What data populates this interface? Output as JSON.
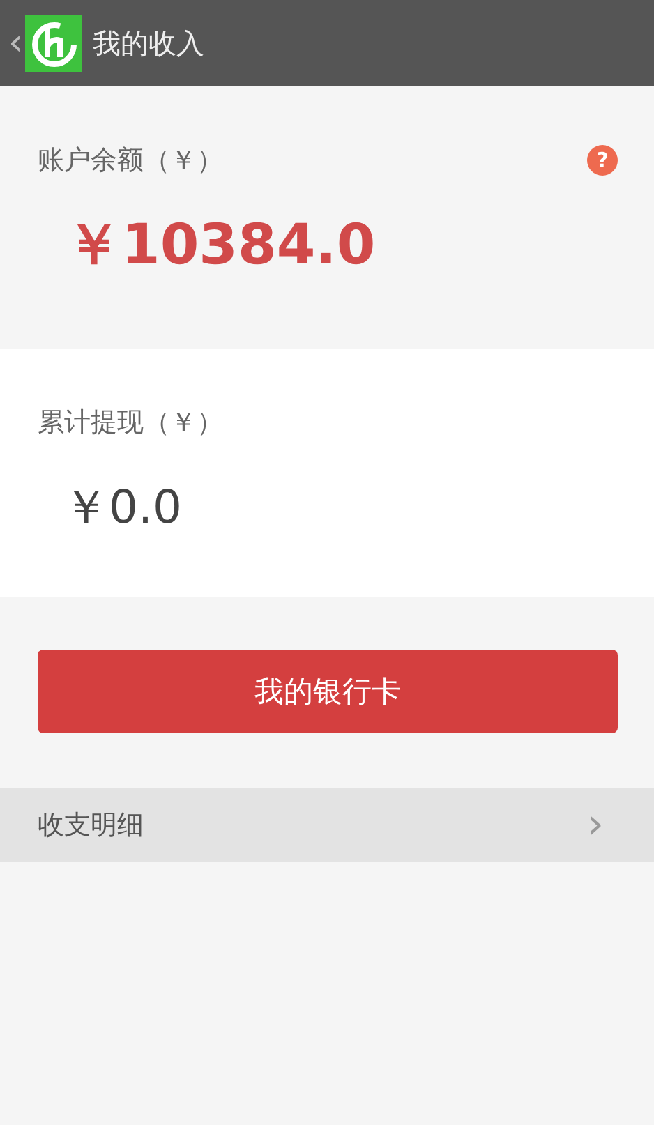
{
  "header": {
    "back": "‹",
    "title": "我的收入"
  },
  "balance": {
    "label": "账户余额（￥）",
    "help": "?",
    "amount": "￥10384.0"
  },
  "withdrawn": {
    "label": "累计提现（￥）",
    "amount": "￥0.0"
  },
  "bank_button": "我的银行卡",
  "details_row": {
    "label": "收支明细",
    "chevron": "›"
  }
}
